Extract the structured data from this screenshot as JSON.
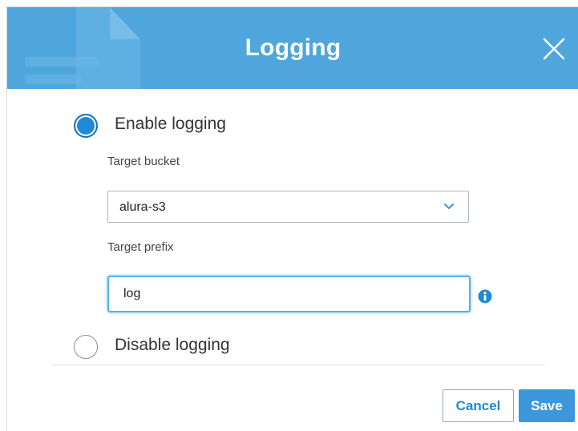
{
  "dialog": {
    "title": "Logging",
    "close_icon": "close-icon"
  },
  "options": {
    "enable_label": "Enable logging",
    "enable_checked": true,
    "disable_label": "Disable logging",
    "disable_checked": false
  },
  "target_bucket": {
    "label": "Target bucket",
    "value": "alura-s3",
    "icon": "chevron-down-icon"
  },
  "target_prefix": {
    "label": "Target prefix",
    "value": "log",
    "info_icon": "info-icon"
  },
  "footer": {
    "cancel_label": "Cancel",
    "save_label": "Save"
  },
  "colors": {
    "header": "#4ea6dc",
    "accent": "#1f8ad6",
    "save_button": "#3d97dd",
    "focus_border": "#55aef0"
  }
}
